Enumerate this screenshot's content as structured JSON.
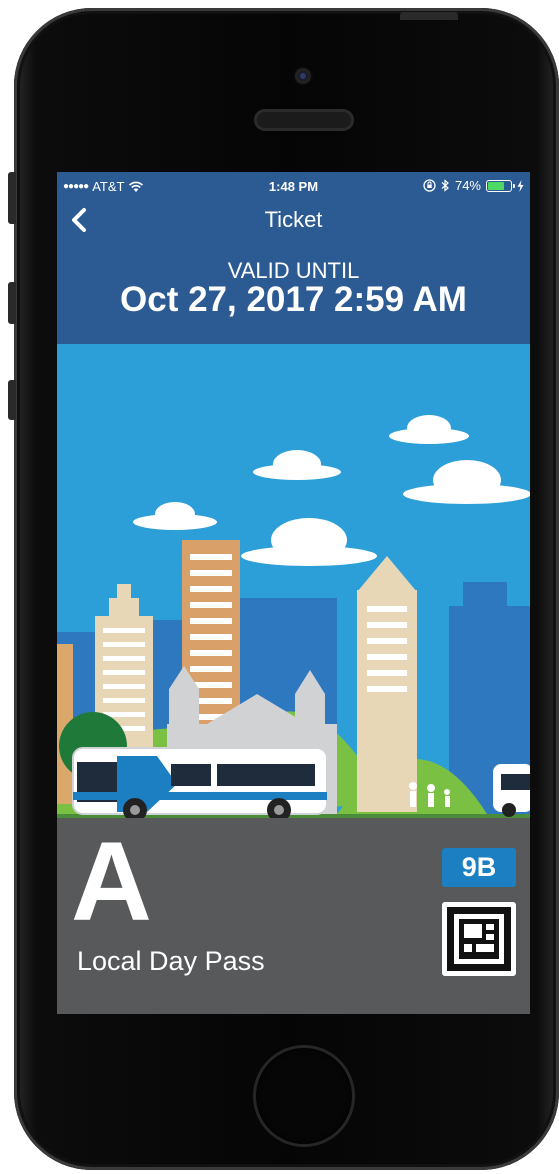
{
  "status_bar": {
    "signal_dots": "●●●●●",
    "carrier": "AT&T",
    "time": "1:48 PM",
    "battery_percent": "74%",
    "battery_level": 0.74
  },
  "nav": {
    "title": "Ticket",
    "back_icon": "chevron-left-icon"
  },
  "validity": {
    "label": "VALID UNTIL",
    "datetime": "Oct 27, 2017 2:59 AM"
  },
  "ticket": {
    "zone": "A",
    "pass_name": "Local Day Pass",
    "route_badge": "9B",
    "qr_icon": "qr-code-icon"
  },
  "colors": {
    "header_blue": "#2c5b94",
    "sky": "#2c9ed8",
    "ticket_bar": "#58595b",
    "badge_blue": "#1b7fc1",
    "battery_green": "#4cd964"
  }
}
